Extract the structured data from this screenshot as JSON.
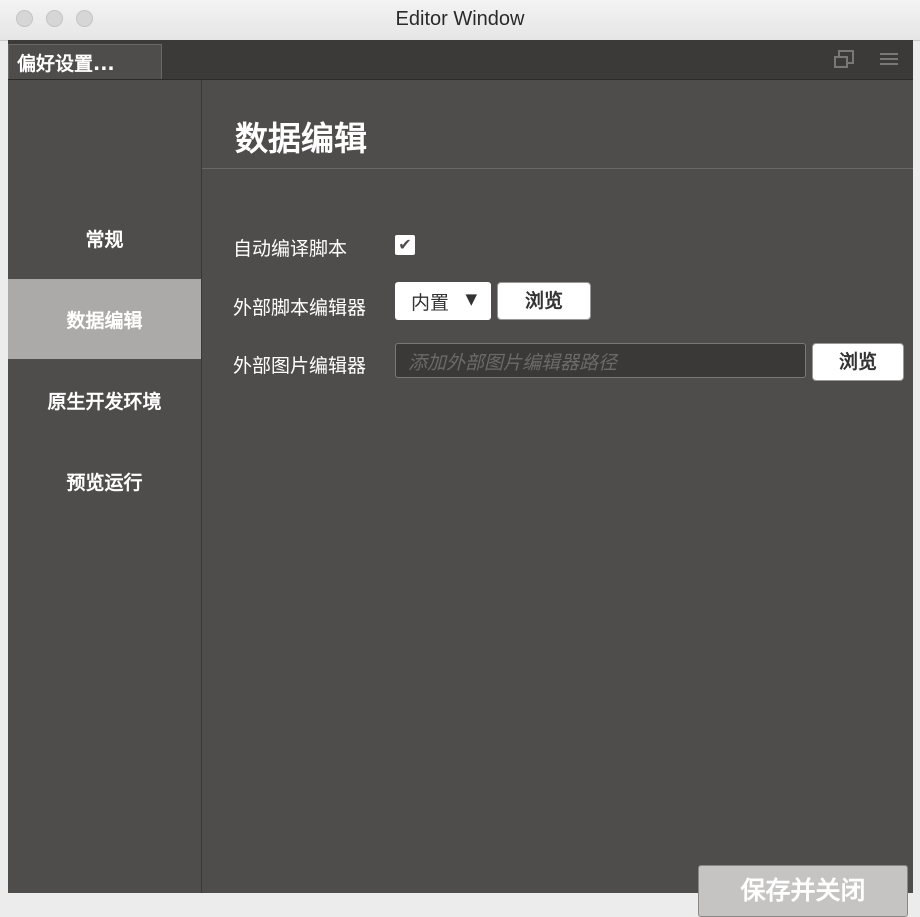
{
  "window": {
    "title": "Editor Window"
  },
  "tabbar": {
    "tab_label": "偏好设置...",
    "icons": [
      "popout-icon",
      "menu-icon"
    ]
  },
  "sidebar": {
    "items": [
      {
        "label": "常规",
        "active": false
      },
      {
        "label": "数据编辑",
        "active": true
      },
      {
        "label": "原生开发环境",
        "active": false
      },
      {
        "label": "预览运行",
        "active": false
      }
    ]
  },
  "main": {
    "title": "数据编辑",
    "auto_compile": {
      "label": "自动编译脚本",
      "checked": true
    },
    "script_editor": {
      "label": "外部脚本编辑器",
      "selected": "内置",
      "browse_label": "浏览"
    },
    "image_editor": {
      "label": "外部图片编辑器",
      "value": "",
      "placeholder": "添加外部图片编辑器路径",
      "browse_label": "浏览"
    },
    "save_label": "保存并关闭"
  },
  "colors": {
    "panel_bg": "#4f4d4c",
    "active_item_bg": "#acaaa8",
    "tabbar_bg": "#3b3a39"
  }
}
